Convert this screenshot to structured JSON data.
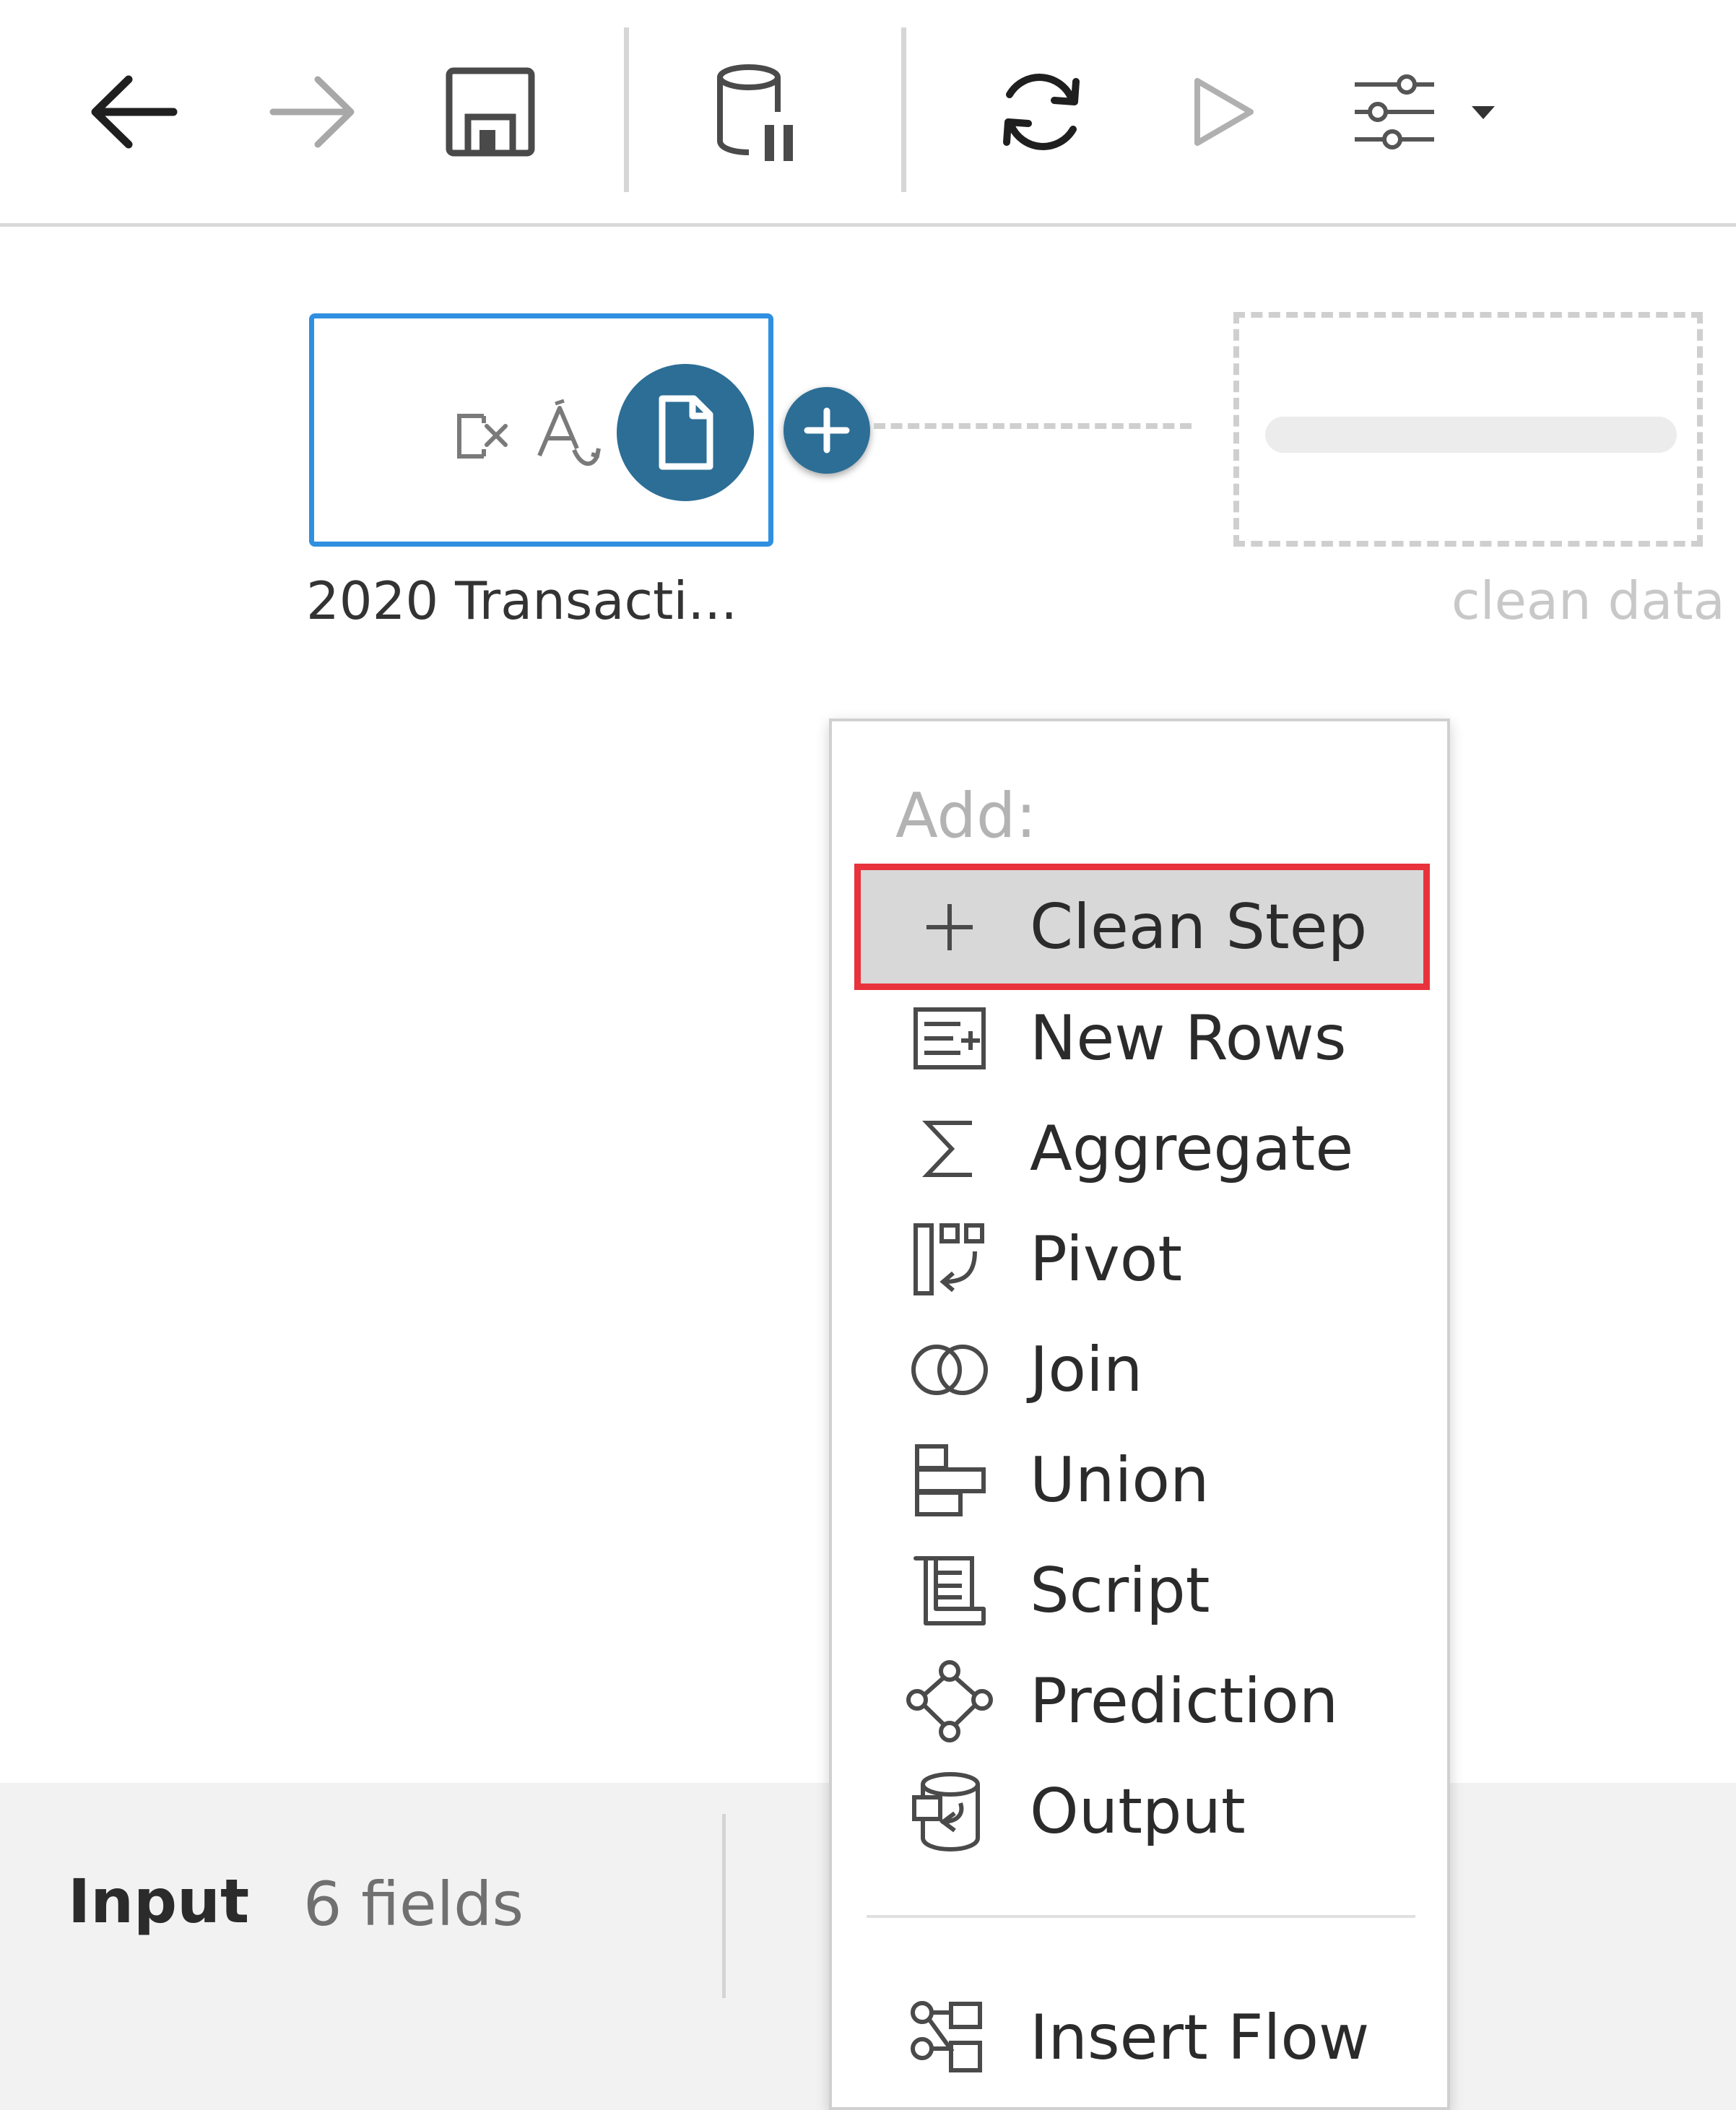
{
  "toolbar": {
    "buttons": [
      {
        "name": "back-button",
        "icon": "arrow-left-icon"
      },
      {
        "name": "forward-button",
        "icon": "arrow-right-icon"
      },
      {
        "name": "save-button",
        "icon": "save-icon"
      },
      {
        "name": "pause-data-updates-button",
        "icon": "database-pause-icon"
      },
      {
        "name": "refresh-button",
        "icon": "refresh-icon"
      },
      {
        "name": "run-flow-button",
        "icon": "play-icon"
      },
      {
        "name": "flow-options-button",
        "icon": "sliders-icon"
      }
    ]
  },
  "canvas": {
    "input_node": {
      "label": "2020 Transacti...",
      "icons": [
        "remove-field-icon",
        "rename-field-icon",
        "file-icon"
      ]
    },
    "add_button_icon": "plus-icon",
    "ghost_step": {
      "label": "clean data"
    }
  },
  "menu": {
    "header": "Add:",
    "items": [
      {
        "label": "Clean Step",
        "icon": "plus-icon",
        "highlighted": true
      },
      {
        "label": "New Rows",
        "icon": "new-rows-icon"
      },
      {
        "label": "Aggregate",
        "icon": "sigma-icon"
      },
      {
        "label": "Pivot",
        "icon": "pivot-icon"
      },
      {
        "label": "Join",
        "icon": "join-icon"
      },
      {
        "label": "Union",
        "icon": "union-icon"
      },
      {
        "label": "Script",
        "icon": "script-icon"
      },
      {
        "label": "Prediction",
        "icon": "prediction-icon"
      },
      {
        "label": "Output",
        "icon": "output-icon"
      }
    ],
    "footer_item": {
      "label": "Insert Flow",
      "icon": "insert-flow-icon"
    }
  },
  "bottom_panel": {
    "title": "Input",
    "field_count": "6 fields"
  },
  "colors": {
    "node_border": "#2f8fe0",
    "node_badge": "#2c6e96",
    "highlight_outline": "#e8323c",
    "highlight_fill": "#d8d8d8"
  }
}
